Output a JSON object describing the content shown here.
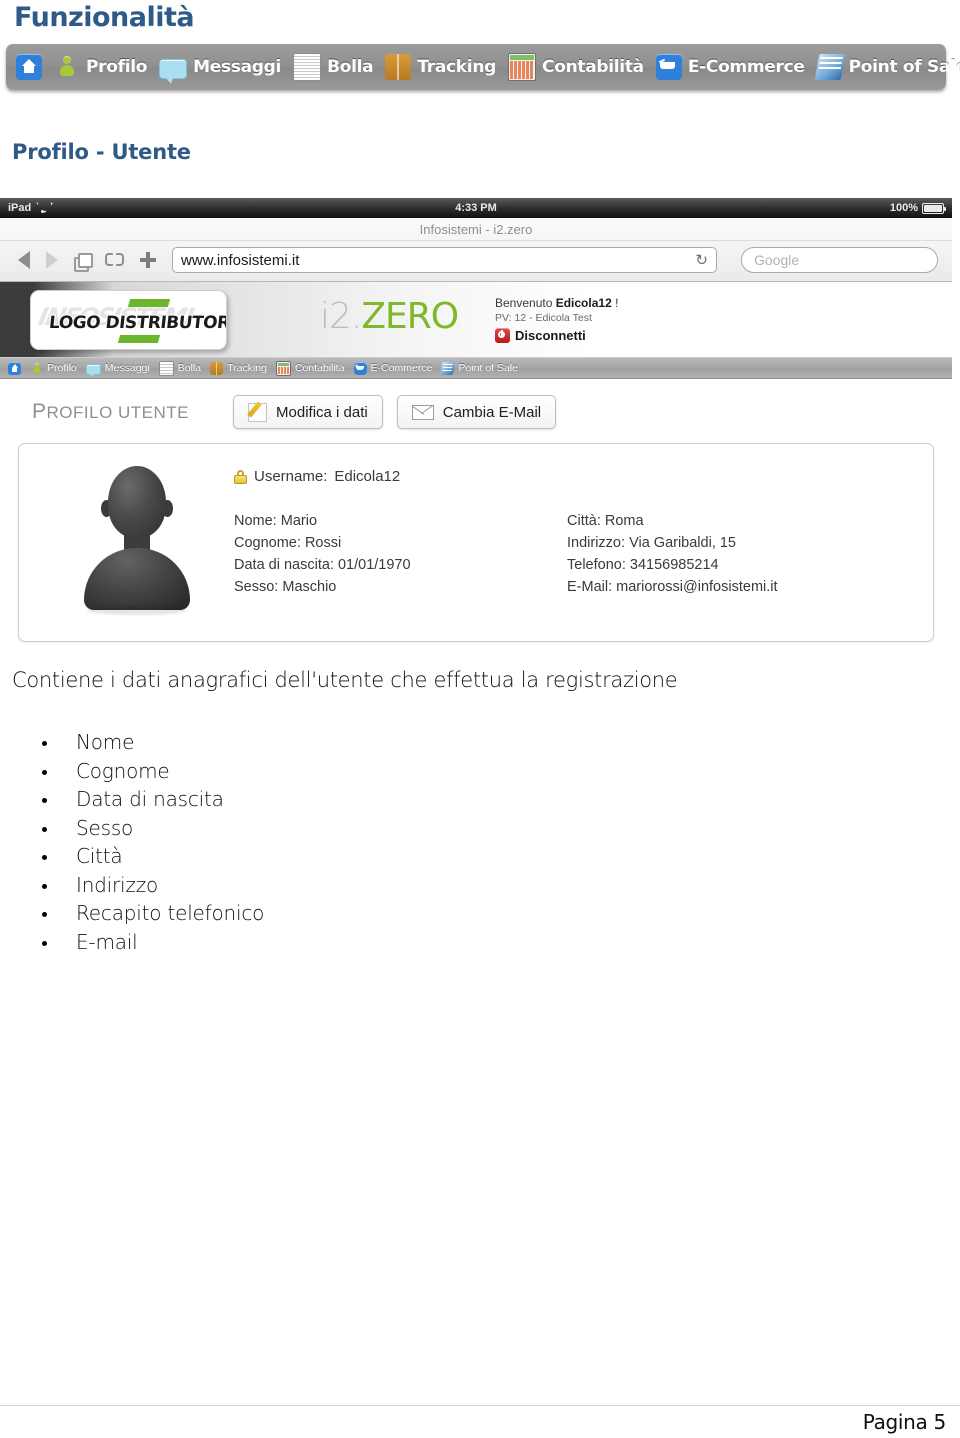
{
  "document": {
    "title": "Funzionalità",
    "section_title": "Profilo - Utente",
    "lead_paragraph": "Contiene i dati anagrafici dell'utente che effettua la registrazione",
    "footer_page": "Pagina 5",
    "title_color": "#2e5a87"
  },
  "doc_navbar": {
    "items": [
      {
        "icon": "home-icon",
        "label": ""
      },
      {
        "icon": "user-icon",
        "label": "Profilo"
      },
      {
        "icon": "message-icon",
        "label": "Messaggi"
      },
      {
        "icon": "document-icon",
        "label": "Bolla"
      },
      {
        "icon": "box-icon",
        "label": "Tracking"
      },
      {
        "icon": "calculator-icon",
        "label": "Contabilità"
      },
      {
        "icon": "cart-icon",
        "label": "E-Commerce"
      },
      {
        "icon": "pos-icon",
        "label": "Point of Sale"
      }
    ]
  },
  "screenshot": {
    "status_bar": {
      "device": "iPad",
      "wifi_icon": "wifi-icon",
      "time": "4:33 PM",
      "battery_percent": "100%",
      "battery_icon": "battery-icon"
    },
    "browser": {
      "tab_title": "Infosistemi - i2.zero",
      "back_icon": "back-arrow-icon",
      "forward_icon": "forward-arrow-icon",
      "tabs_icon": "tabs-icon",
      "bookmarks_icon": "book-icon",
      "add_icon": "plus-icon",
      "url_value": "www.infosistemi.it",
      "reload_icon": "reload-icon",
      "search_placeholder": "Google"
    },
    "app_header": {
      "logo_placeholder": "LOGO DISTRIBUTORE",
      "logo_ghost_text": "INFOSISTEMI",
      "brand_prefix": "i2",
      "brand_dot": ".",
      "brand_suffix": "ZERO",
      "welcome_prefix": "Benvenuto ",
      "welcome_user": "Edicola12",
      "welcome_suffix": " !",
      "pv_line": "PV: 12 - Edicola Test",
      "logout_label": "Disconnetti",
      "logout_icon": "power-icon",
      "brand_green": "#7fb929"
    },
    "app_nav": {
      "items": [
        {
          "icon": "home-icon",
          "label": ""
        },
        {
          "icon": "user-icon",
          "label": "Profilo"
        },
        {
          "icon": "message-icon",
          "label": "Messaggi"
        },
        {
          "icon": "document-icon",
          "label": "Bolla"
        },
        {
          "icon": "box-icon",
          "label": "Tracking"
        },
        {
          "icon": "calculator-icon",
          "label": "Contabilità"
        },
        {
          "icon": "cart-icon",
          "label": "E-Commerce"
        },
        {
          "icon": "pos-icon",
          "label": "Point of Sale"
        }
      ]
    },
    "profile": {
      "heading_cap": "P",
      "heading_rest": "ROFILO UTENTE",
      "edit_button": "Modifica i dati",
      "edit_icon": "pencil-icon",
      "email_button": "Cambia E-Mail",
      "email_icon": "mail-icon",
      "avatar_icon": "avatar-silhouette",
      "lock_icon": "lock-icon",
      "username_label": "Username:",
      "username_value": "Edicola12",
      "fields_left": [
        {
          "label": "Nome:",
          "value": "Mario"
        },
        {
          "label": "Cognome:",
          "value": "Rossi"
        },
        {
          "label": "Data di nascita:",
          "value": "01/01/1970"
        },
        {
          "label": "Sesso:",
          "value": "Maschio"
        }
      ],
      "fields_right": [
        {
          "label": "Città:",
          "value": "Roma"
        },
        {
          "label": "Indirizzo:",
          "value": "Via Garibaldi, 15"
        },
        {
          "label": "Telefono:",
          "value": "34156985214"
        },
        {
          "label": "E-Mail:",
          "value": "mariorossi@infosistemi.it"
        }
      ]
    }
  },
  "bullets": [
    "Nome",
    "Cognome",
    "Data di nascita",
    "Sesso",
    "Città",
    "Indirizzo",
    "Recapito telefonico",
    "E-mail"
  ]
}
